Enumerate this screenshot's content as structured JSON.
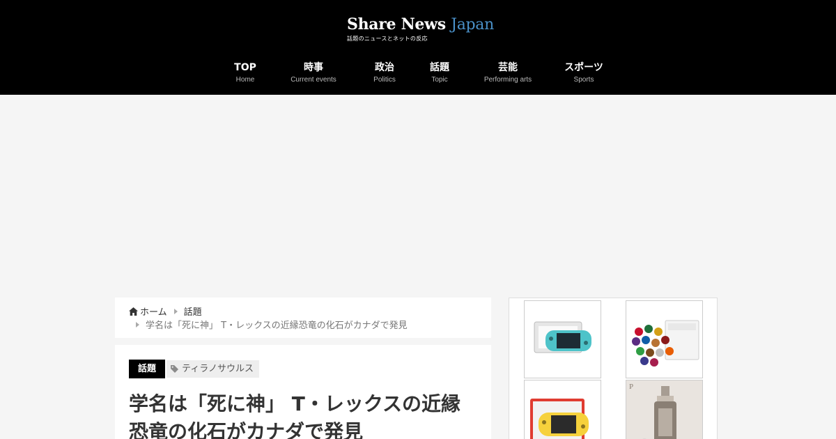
{
  "site": {
    "logo_main": "Share News ",
    "logo_accent": "Japan",
    "logo_sub": "話題のニュースとネットの反応"
  },
  "nav": [
    {
      "label": "TOP",
      "sub": "Home"
    },
    {
      "label": "時事",
      "sub": "Current events"
    },
    {
      "label": "政治",
      "sub": "Politics"
    },
    {
      "label": "話題",
      "sub": "Topic"
    },
    {
      "label": "芸能",
      "sub": "Performing arts"
    },
    {
      "label": "スポーツ",
      "sub": "Sports"
    }
  ],
  "breadcrumb": {
    "home": "ホーム",
    "category": "話題",
    "current": "学名は「死に神」 T・レックスの近縁恐竜の化石がカナダで発見"
  },
  "article": {
    "category": "話題",
    "tag": "ティラノサウルス",
    "title_line1": "学名は「死に神」 T・レックスの近縁",
    "title_line2": "恐竜の化石がカナダで発見"
  },
  "sidebar": {
    "products": [
      {
        "icon": "game-console-icon",
        "color": "#4ec3c9"
      },
      {
        "icon": "chocolate-box-icon",
        "color": "#c8102e"
      },
      {
        "icon": "game-console-icon",
        "color": "#f6d13c"
      },
      {
        "icon": "cosmetic-bottle-icon",
        "color": "#8a7f74"
      }
    ]
  }
}
